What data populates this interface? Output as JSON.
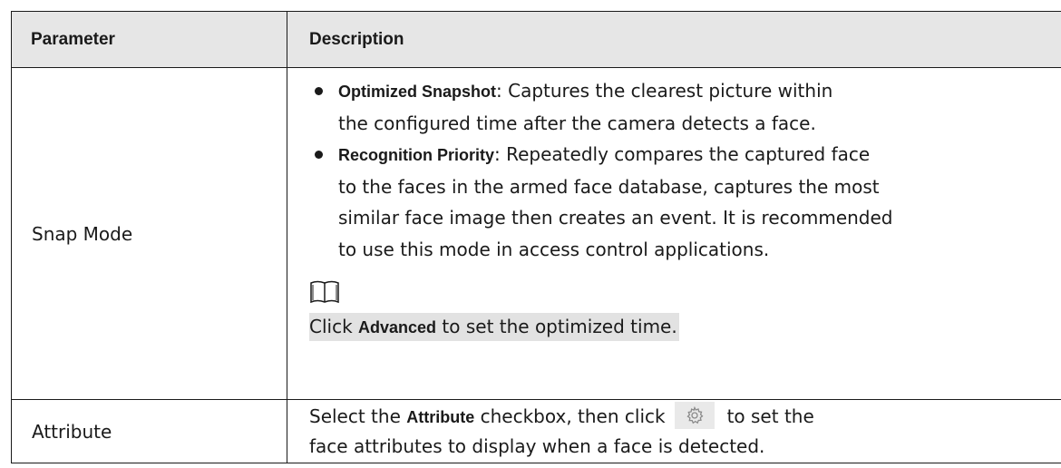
{
  "table": {
    "headers": {
      "parameter": "Parameter",
      "description": "Description"
    },
    "snap_mode": {
      "param": "Snap Mode",
      "bullets": [
        {
          "term": "Optimized Snapshot",
          "sep": ":",
          "line1": " Captures the clearest picture within",
          "line2": "the configured time after the camera detects a face."
        },
        {
          "term": "Recognition Priority",
          "sep": ":",
          "line1": " Repeatedly compares the captured face",
          "line2": "to the faces in the armed face database, captures the most",
          "line3": "similar face image then creates an event. It is recommended",
          "line4": "to use this mode in access control applications."
        }
      ],
      "note": {
        "icon": "book-note-icon",
        "prefix": "Click ",
        "bold": "Advanced",
        "suffix": " to set the optimized time."
      }
    },
    "attribute": {
      "param": "Attribute",
      "line1_prefix": "Select the ",
      "line1_bold": "Attribute",
      "line1_mid": " checkbox, then click",
      "line1_suffix": "to set the",
      "line2": "face attributes to display when a face is detected.",
      "icon": "gear-icon"
    }
  }
}
